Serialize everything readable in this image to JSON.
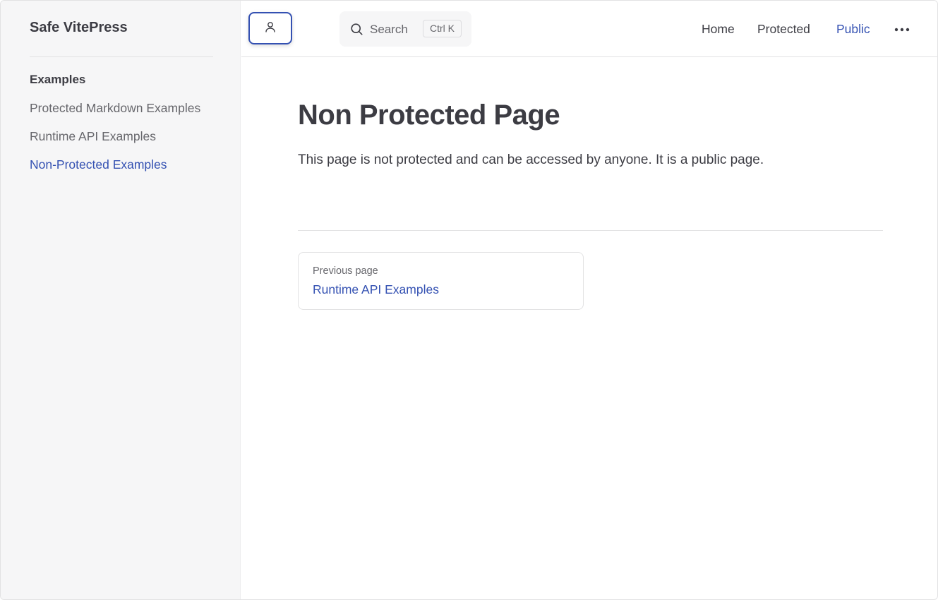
{
  "site": {
    "title": "Safe VitePress"
  },
  "sidebar": {
    "group_title": "Examples",
    "items": [
      {
        "label": "Protected Markdown Examples",
        "active": false
      },
      {
        "label": "Runtime API Examples",
        "active": false
      },
      {
        "label": "Non-Protected Examples",
        "active": true
      }
    ]
  },
  "topbar": {
    "user_icon": "user-icon",
    "search": {
      "label": "Search",
      "shortcut": "Ctrl K",
      "icon": "search-icon"
    },
    "nav": [
      {
        "label": "Home",
        "active": false
      },
      {
        "label": "Protected",
        "active": false
      },
      {
        "label": "Public",
        "active": true
      }
    ],
    "more_icon": "more-horizontal-icon"
  },
  "main": {
    "title": "Non Protected Page",
    "text": "This page is not protected and can be accessed by anyone. It is a public page.",
    "prev": {
      "desc": "Previous page",
      "title": "Runtime API Examples"
    }
  },
  "colors": {
    "brand": "#3451b2",
    "text": "#3c3c43",
    "muted": "#67676c",
    "sidebar_bg": "#f6f6f7"
  }
}
